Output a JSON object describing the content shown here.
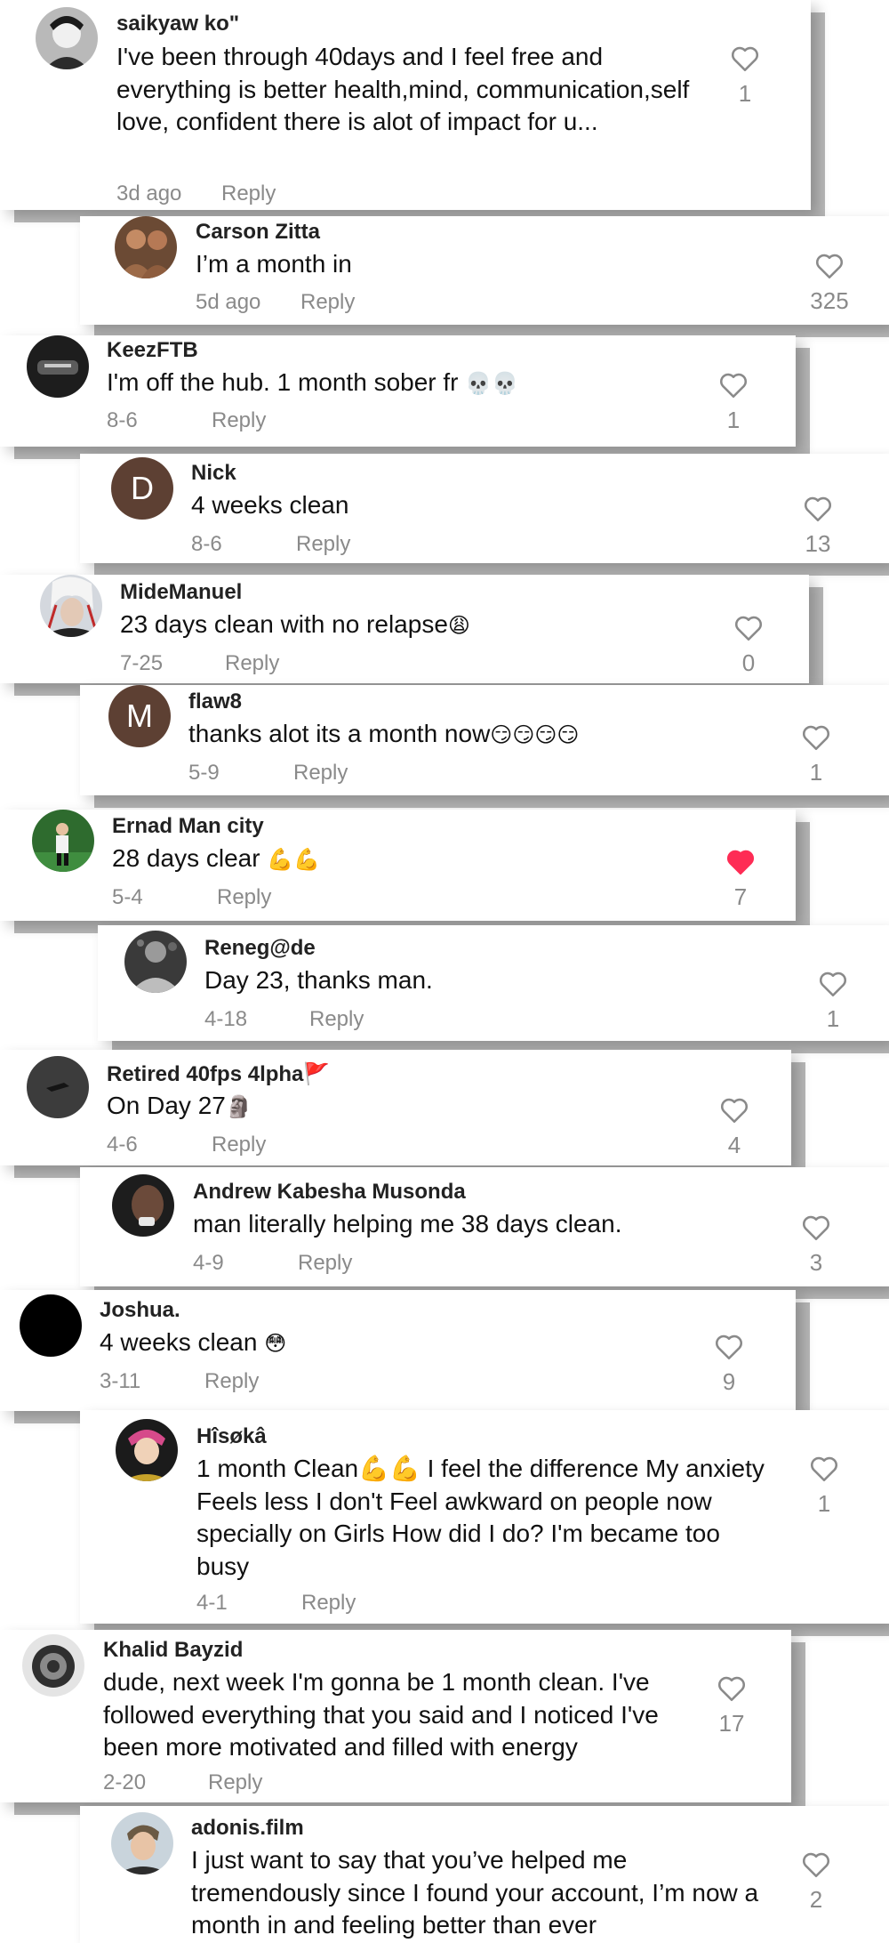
{
  "comments": [
    {
      "username": "saikyaw ko\"",
      "text": "I've been through 40days and I feel free and everything is better health,mind, communication,self love, confident there is alot of impact for u...",
      "date": "3d ago",
      "reply": "Reply",
      "likes": "1",
      "liked": false,
      "avatar": "photo-avatar"
    },
    {
      "username": "Carson Zitta",
      "text": "I’m a month in",
      "date": "5d ago",
      "reply": "Reply",
      "likes": "325",
      "liked": false,
      "avatar": "photo-avatar"
    },
    {
      "username": "KeezFTB",
      "text": "I'm off the hub. 1 month sober fr",
      "emoji": "💀💀",
      "date": "8-6",
      "reply": "Reply",
      "likes": "1",
      "liked": false,
      "avatar": "photo-avatar"
    },
    {
      "username": "Nick",
      "text": "4 weeks clean",
      "date": "8-6",
      "reply": "Reply",
      "likes": "13",
      "liked": false,
      "avatar": "letter-avatar",
      "avatar_letter": "D",
      "avatar_color": "#5d4033"
    },
    {
      "username": "MideManuel",
      "text": "23 days clean with no relapse",
      "emoji": "😩",
      "date": "7-25",
      "reply": "Reply",
      "likes": "0",
      "liked": false,
      "avatar": "photo-avatar"
    },
    {
      "username": "flaw8",
      "text": "thanks alot its a month now",
      "emoji": "😏😏😏😏",
      "date": "5-9",
      "reply": "Reply",
      "likes": "1",
      "liked": false,
      "avatar": "letter-avatar",
      "avatar_letter": "M",
      "avatar_color": "#5d4033"
    },
    {
      "username": "Ernad Man city",
      "text": "28 days clear",
      "emoji": "💪💪",
      "date": "5-4",
      "reply": "Reply",
      "likes": "7",
      "liked": true,
      "avatar": "photo-avatar"
    },
    {
      "username": "Reneg@de",
      "text": "Day 23, thanks man.",
      "date": "4-18",
      "reply": "Reply",
      "likes": "1",
      "liked": false,
      "avatar": "photo-avatar"
    },
    {
      "username": "Retired 40fps 4lpha",
      "username_emoji": "🚩",
      "text": "On Day 27",
      "emoji": "🗿",
      "date": "4-6",
      "reply": "Reply",
      "likes": "4",
      "liked": false,
      "avatar": "photo-avatar"
    },
    {
      "username": "Andrew Kabesha Musonda",
      "text": "man literally helping me 38 days clean.",
      "date": "4-9",
      "reply": "Reply",
      "likes": "3",
      "liked": false,
      "avatar": "photo-avatar"
    },
    {
      "username": "Joshua.",
      "text": "4 weeks clean",
      "emoji": "😳",
      "date": "3-11",
      "reply": "Reply",
      "likes": "9",
      "liked": false,
      "avatar": "black-avatar"
    },
    {
      "username": "Hîsøkâ",
      "text": "1 month Clean💪💪 I feel the difference My anxiety Feels less I don't Feel awkward on people now specially on Girls How did I do? I'm became too busy",
      "date": "4-1",
      "reply": "Reply",
      "likes": "1",
      "liked": false,
      "avatar": "photo-avatar"
    },
    {
      "username": "Khalid Bayzid",
      "text": "dude, next week I'm gonna be 1 month clean. I've followed everything that you said and I noticed I've been more motivated and filled with energy",
      "date": "2-20",
      "reply": "Reply",
      "likes": "17",
      "liked": false,
      "avatar": "photo-avatar"
    },
    {
      "username": "adonis.film",
      "text": "I just want to say that you’ve helped me tremendously since I found your account, I’m now a month in and feeling better than ever",
      "date": "",
      "reply": "",
      "likes": "2",
      "liked": false,
      "avatar": "photo-avatar"
    }
  ],
  "colors": {
    "liked_heart": "#fe2c55",
    "muted_text": "#8a8a8a"
  }
}
